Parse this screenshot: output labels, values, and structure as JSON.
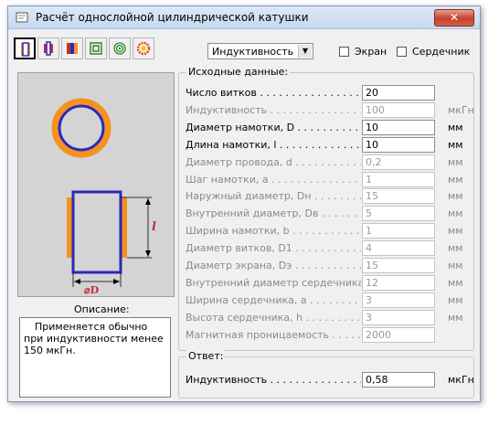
{
  "window": {
    "title": "Расчёт однослойной цилиндрической катушки",
    "close_label": "✕"
  },
  "toolbar": {
    "buttons": [
      {
        "name": "single-layer-coil",
        "active": true
      },
      {
        "name": "multi-layer-coil"
      },
      {
        "name": "ring-coil"
      },
      {
        "name": "flat-square-coil"
      },
      {
        "name": "flat-spiral-coil"
      },
      {
        "name": "toroid-coil"
      }
    ],
    "mode_select": {
      "value": "Индуктивность"
    }
  },
  "options": {
    "screen_label": "Экран",
    "core_label": "Сердечник"
  },
  "diagram": {
    "length_label": "l",
    "diameter_label": "⌀D",
    "colors": {
      "wire": "#f5921e",
      "coil": "#2a2ab8",
      "background": "#d4d4d4"
    }
  },
  "description": {
    "label": "Описание:",
    "lines": [
      "Применяется обычно",
      "при индуктивности менее",
      "150 мкГн."
    ]
  },
  "input_group": {
    "title": "Исходные данные:",
    "rows": [
      {
        "label": "Число витков . . . . . . . . . . . . . . . . . . . .",
        "value": "20",
        "unit": "",
        "enabled": true
      },
      {
        "label": "Индуктивность . . . . . . . . . . . . . . . . . . .",
        "value": "100",
        "unit": "мкГн",
        "enabled": false
      },
      {
        "label": "Диаметр намотки, D . . . . . . . . . . . . . .",
        "value": "10",
        "unit": "мм",
        "enabled": true
      },
      {
        "label": "Длина намотки, l . . . . . . . . . . . . . . . .",
        "value": "10",
        "unit": "мм",
        "enabled": true
      },
      {
        "label": "Диаметр провода, d . . . . . . . . . . . . . .",
        "value": "0,2",
        "unit": "мм",
        "enabled": false
      },
      {
        "label": "Шаг намотки, a . . . . . . . . . . . . . . . . . .",
        "value": "1",
        "unit": "мм",
        "enabled": false
      },
      {
        "label": "Наружный диаметр, Dн . . . . . . . . . . . .",
        "value": "15",
        "unit": "мм",
        "enabled": false
      },
      {
        "label": "Внутренний диаметр, Dв . . . . . . . . . . .",
        "value": "5",
        "unit": "мм",
        "enabled": false
      },
      {
        "label": "Ширина намотки, b . . . . . . . . . . . . . . .",
        "value": "1",
        "unit": "мм",
        "enabled": false
      },
      {
        "label": "Диаметр витков, D1 . . . . . . . . . . . . . .",
        "value": "4",
        "unit": "мм",
        "enabled": false
      },
      {
        "label": "Диаметр экрана, Dэ . . . . . . . . . . . . . .",
        "value": "15",
        "unit": "мм",
        "enabled": false
      },
      {
        "label": "Внутренний диаметр сердечника, D",
        "value": "12",
        "unit": "мм",
        "enabled": false
      },
      {
        "label": "Ширина сердечника, a . . . . . . . . . . . . .",
        "value": "3",
        "unit": "мм",
        "enabled": false
      },
      {
        "label": "Высота сердечника, h . . . . . . . . . . . . .",
        "value": "3",
        "unit": "мм",
        "enabled": false
      },
      {
        "label": "Магнитная проницаемость . . . . . . . . .",
        "value": "2000",
        "unit": "",
        "enabled": false
      }
    ]
  },
  "answer_group": {
    "title": "Ответ:",
    "label": "Индуктивность . . . . . . . . . . . . . . . . . . .",
    "value": "0,58",
    "unit": "мкГн"
  }
}
